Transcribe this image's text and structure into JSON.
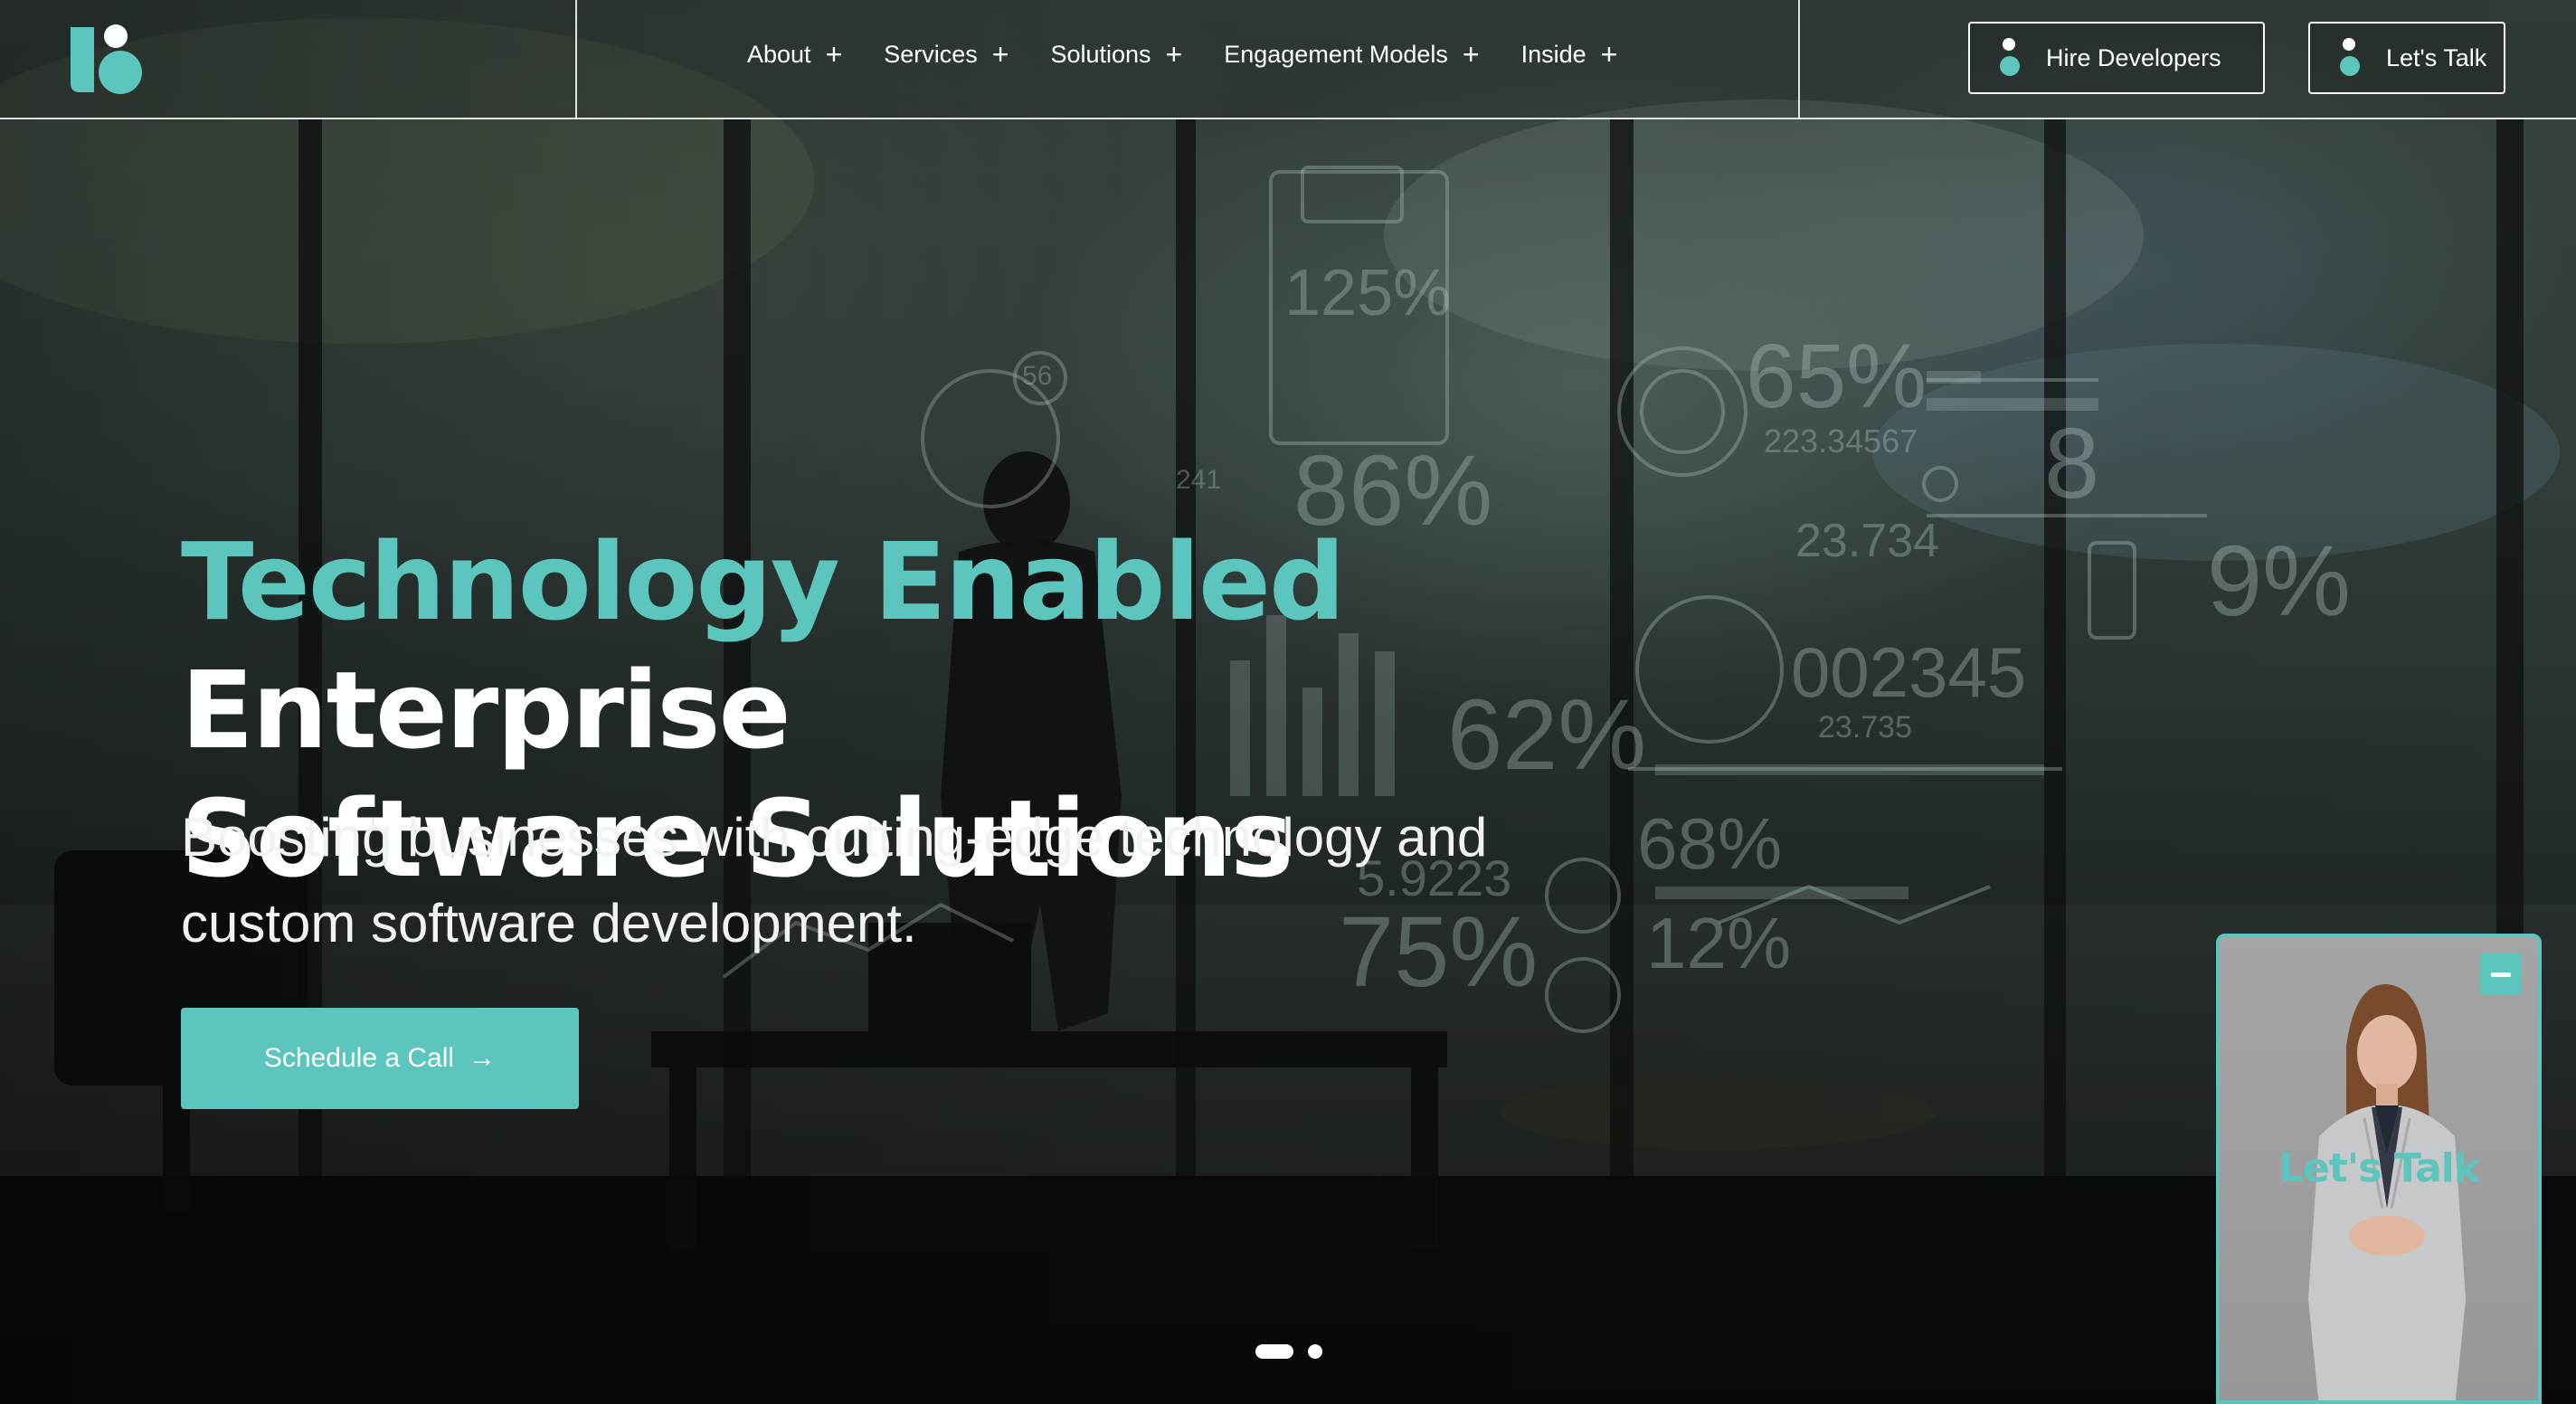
{
  "header": {
    "nav": [
      {
        "label": "About",
        "icon": "plus-icon"
      },
      {
        "label": "Services",
        "icon": "plus-icon"
      },
      {
        "label": "Solutions",
        "icon": "plus-icon"
      },
      {
        "label": "Engagement Models",
        "icon": "plus-icon"
      },
      {
        "label": "Inside",
        "icon": "plus-icon"
      }
    ],
    "buttons": {
      "hire": "Hire Developers",
      "talk": "Let's Talk"
    }
  },
  "hero": {
    "headline_accent": "Technology Enabled",
    "headline_rest_line1": "Enterprise",
    "headline_line2": "Software Solutions",
    "subtext": "Boosting businesses with cutting-edge technology and custom software development.",
    "cta": "Schedule a Call",
    "cta_icon": "arrow-right-icon"
  },
  "carousel": {
    "slides": 2,
    "active": 1
  },
  "widget": {
    "label": "Let's Talk",
    "minimize_icon": "minimize-icon"
  },
  "background_readouts": [
    "125%",
    "86%",
    "65%",
    "223.34567",
    "23.734",
    "9%",
    "002345",
    "62%",
    "23.735",
    "68%",
    "5.9223",
    "75%",
    "12%",
    "8",
    "56",
    "241"
  ],
  "colors": {
    "accent": "#5cc5bd",
    "text": "#ffffff"
  }
}
